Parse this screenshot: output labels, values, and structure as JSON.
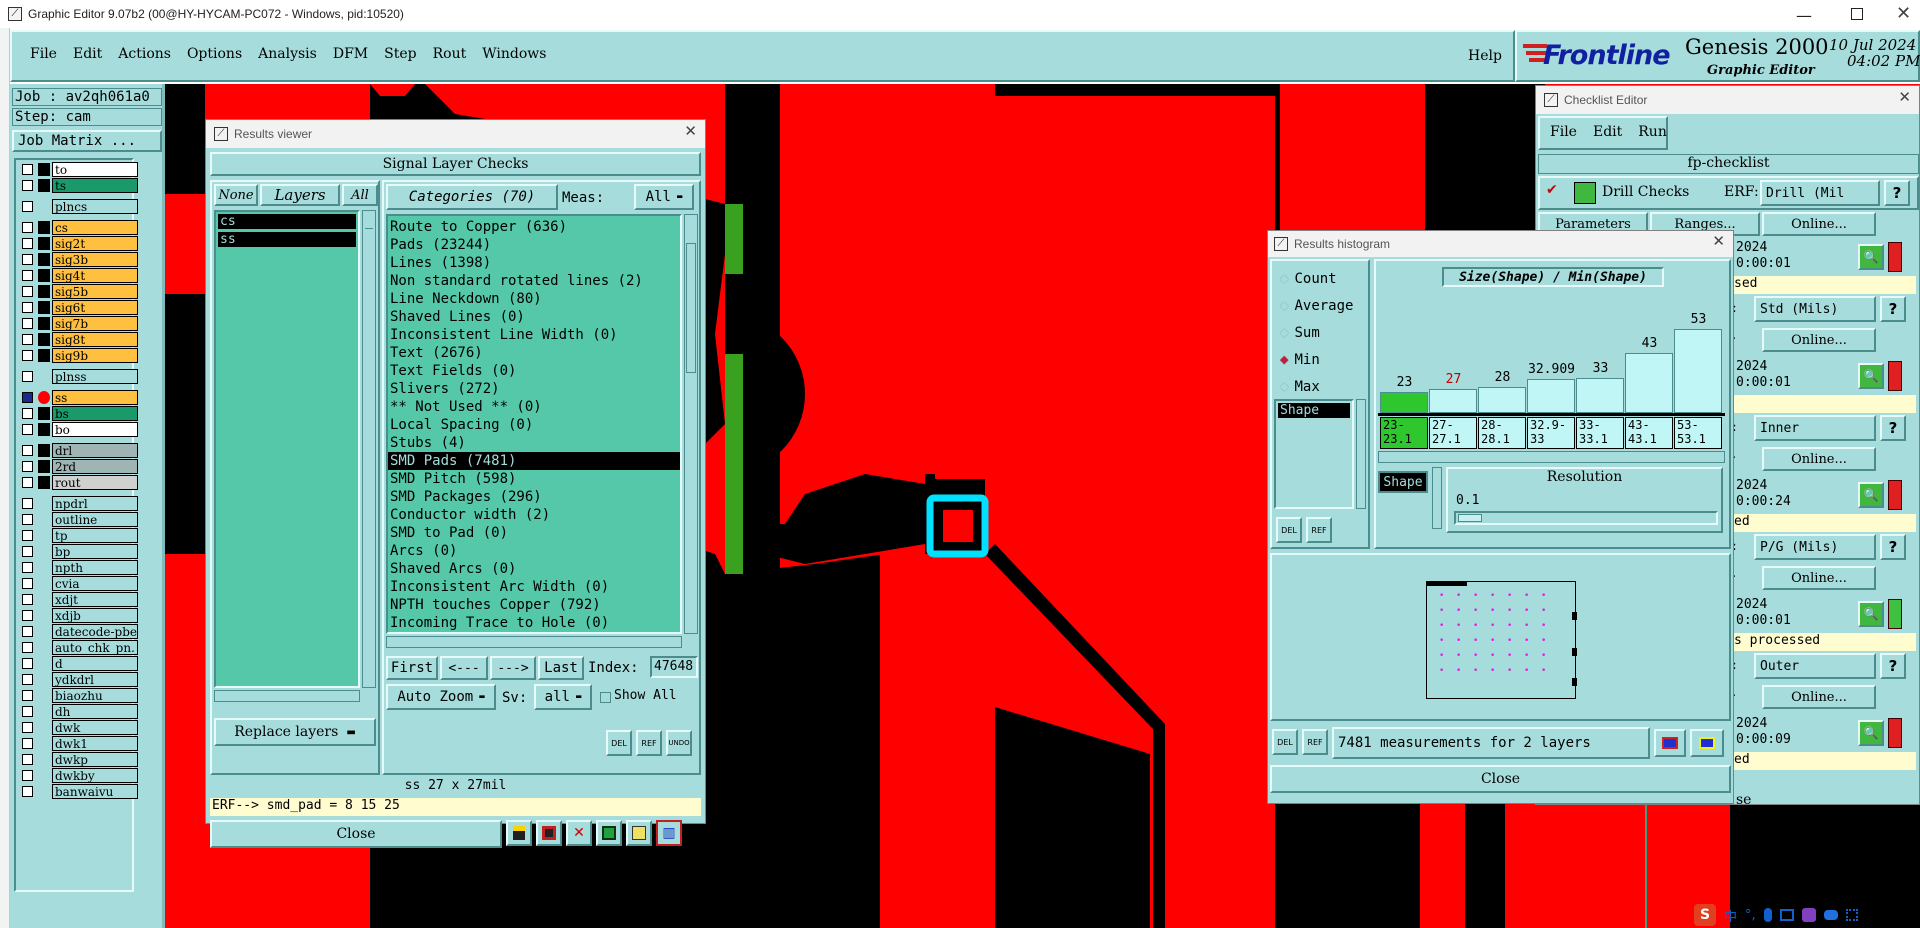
{
  "window": {
    "title": "Graphic Editor 9.07b2 (00@HY-HYCAM-PC072 - Windows, pid:10520)"
  },
  "menu": [
    "File",
    "Edit",
    "Actions",
    "Options",
    "Analysis",
    "DFM",
    "Step",
    "Rout",
    "Windows"
  ],
  "help": "Help",
  "brand": {
    "logo": "Frontline",
    "product": "Genesis 2000",
    "sub": "Graphic Editor",
    "date": "10 Jul 2024",
    "time": "04:02 PM"
  },
  "job": {
    "job": "Job : av2qh061a0",
    "step": "Step: cam",
    "matrix": "Job Matrix ..."
  },
  "layers": [
    {
      "name": "to",
      "color": "#ffffff",
      "box": "#000000"
    },
    {
      "name": "ts",
      "color": "#1a9a6a",
      "box": "#000000"
    },
    {
      "name": "plncs",
      "color": "#a6dcdc",
      "box": "#a6dcdc",
      "gap": true
    },
    {
      "name": "cs",
      "color": "#ffc040",
      "box": "#000000",
      "gap": true
    },
    {
      "name": "sig2t",
      "color": "#ffc040",
      "box": "#000000"
    },
    {
      "name": "sig3b",
      "color": "#ffc040",
      "box": "#000000"
    },
    {
      "name": "sig4t",
      "color": "#ffc040",
      "box": "#000000"
    },
    {
      "name": "sig5b",
      "color": "#ffc040",
      "box": "#000000"
    },
    {
      "name": "sig6t",
      "color": "#ffc040",
      "box": "#000000"
    },
    {
      "name": "sig7b",
      "color": "#ffc040",
      "box": "#000000"
    },
    {
      "name": "sig8t",
      "color": "#ffc040",
      "box": "#000000"
    },
    {
      "name": "sig9b",
      "color": "#ffc040",
      "box": "#000000"
    },
    {
      "name": "plnss",
      "color": "#a6dcdc",
      "box": "#a6dcdc",
      "gap": true
    },
    {
      "name": "ss",
      "color": "#ffc040",
      "box": "#ff0000",
      "sel": true,
      "gap": true
    },
    {
      "name": "bs",
      "color": "#1a9a6a",
      "box": "#000000"
    },
    {
      "name": "bo",
      "color": "#ffffff",
      "box": "#000000"
    },
    {
      "name": "drl",
      "color": "#a0b4b4",
      "box": "#000000",
      "gap": true
    },
    {
      "name": "2rd",
      "color": "#a0b4b4",
      "box": "#000000"
    },
    {
      "name": "rout",
      "color": "#d0d0d0",
      "box": "#000000"
    },
    {
      "name": "npdrl",
      "color": "#a6dcdc",
      "box": "#a6dcdc",
      "gap": true
    },
    {
      "name": "outline",
      "color": "#a6dcdc",
      "box": "#a6dcdc"
    },
    {
      "name": "tp",
      "color": "#a6dcdc",
      "box": "#a6dcdc"
    },
    {
      "name": "bp",
      "color": "#a6dcdc",
      "box": "#a6dcdc"
    },
    {
      "name": "npth",
      "color": "#a6dcdc",
      "box": "#a6dcdc"
    },
    {
      "name": "cvia",
      "color": "#a6dcdc",
      "box": "#a6dcdc"
    },
    {
      "name": "xdjt",
      "color": "#a6dcdc",
      "box": "#a6dcdc"
    },
    {
      "name": "xdjb",
      "color": "#a6dcdc",
      "box": "#a6dcdc"
    },
    {
      "name": "datecode-pbe",
      "color": "#a6dcdc",
      "box": "#a6dcdc"
    },
    {
      "name": "auto_chk_pn.",
      "color": "#a6dcdc",
      "box": "#a6dcdc"
    },
    {
      "name": "d",
      "color": "#a6dcdc",
      "box": "#a6dcdc"
    },
    {
      "name": "ydkdrl",
      "color": "#a6dcdc",
      "box": "#a6dcdc"
    },
    {
      "name": "biaozhu",
      "color": "#a6dcdc",
      "box": "#a6dcdc"
    },
    {
      "name": "dh",
      "color": "#a6dcdc",
      "box": "#a6dcdc"
    },
    {
      "name": "dwk",
      "color": "#a6dcdc",
      "box": "#a6dcdc"
    },
    {
      "name": "dwk1",
      "color": "#a6dcdc",
      "box": "#a6dcdc"
    },
    {
      "name": "dwkp",
      "color": "#a6dcdc",
      "box": "#a6dcdc"
    },
    {
      "name": "dwkby",
      "color": "#a6dcdc",
      "box": "#a6dcdc"
    },
    {
      "name": "banwaivu",
      "color": "#a6dcdc",
      "box": "#a6dcdc"
    }
  ],
  "results": {
    "title": "Results viewer",
    "header": "Signal Layer Checks",
    "none": "None",
    "layers_label": "Layers",
    "all": "All",
    "categories_label": "Categories (70)",
    "meas_label": "Meas:",
    "meas_value": "All",
    "layer_list": [
      "cs",
      "ss"
    ],
    "categories": [
      "Route to Copper (636)",
      "Pads (23244)",
      "Lines (1398)",
      "Non standard rotated lines (2)",
      "Line Neckdown (80)",
      "Shaved Lines (0)",
      "Inconsistent Line Width (0)",
      "Text (2676)",
      "Text Fields (0)",
      "Slivers (272)",
      "** Not Used ** (0)",
      "Local Spacing (0)",
      "Stubs (4)",
      "SMD Pads (7481)",
      "SMD Pitch (598)",
      "SMD Packages (296)",
      "Conductor width (2)",
      "SMD to Pad (0)",
      "Arcs (0)",
      "Shaved Arcs (0)",
      "Inconsistent Arc Width (0)",
      "NPTH touches Copper (792)",
      "Incoming Trace to Hole (0)"
    ],
    "selected_index": 13,
    "first": "First",
    "prev": "<---",
    "next": "--->",
    "last": "Last",
    "index_label": "Index:",
    "index_value": "47648",
    "zoom": "Auto Zoom",
    "sv_label": "Sv:",
    "sv_value": "all",
    "show_all": "Show All",
    "replace": "Replace layers",
    "del": "DEL",
    "ref": "REF",
    "undo": "UNDO",
    "info": "ss 27 x 27mil",
    "erf": "ERF--> smd_pad = 8 15 25",
    "close": "Close"
  },
  "histogram": {
    "title": "Results histogram",
    "options": [
      {
        "label": "Count",
        "on": false
      },
      {
        "label": "Average",
        "on": false
      },
      {
        "label": "Sum",
        "on": false
      },
      {
        "label": "Min",
        "on": true
      },
      {
        "label": "Max",
        "on": false
      }
    ],
    "shape_list": [
      "Shape"
    ],
    "chart_title": "Size(Shape) / Min(Shape)",
    "bars": [
      {
        "value": "23",
        "fill": 0.17,
        "color": "#2ec82e",
        "label": "23- 23.1",
        "red": false
      },
      {
        "value": "27",
        "fill": 0.2,
        "color": "#c0f6f6",
        "label": "27- 27.1",
        "red": true
      },
      {
        "value": "28",
        "fill": 0.21,
        "color": "#c0f6f6",
        "label": "28- 28.1",
        "red": false
      },
      {
        "value": "32.909",
        "fill": 0.28,
        "color": "#c0f6f6",
        "label": "32.9- 33",
        "red": false
      },
      {
        "value": "33",
        "fill": 0.29,
        "color": "#c0f6f6",
        "label": "33- 33.1",
        "red": false
      },
      {
        "value": "43",
        "fill": 0.49,
        "color": "#c0f6f6",
        "label": "43- 43.1",
        "red": false
      },
      {
        "value": "53",
        "fill": 0.69,
        "color": "#c0f6f6",
        "label": "53- 53.1",
        "red": false
      }
    ],
    "shape_tag": "Shape",
    "resolution_label": "Resolution",
    "resolution_value": "0.1",
    "del": "DEL",
    "ref": "REF",
    "summary": "7481 measurements for 2 layers",
    "close": "Close"
  },
  "checklist": {
    "title": "Checklist Editor",
    "menu": [
      "File",
      "Edit",
      "Run"
    ],
    "name": "fp-checklist",
    "drill_checks": "Drill Checks",
    "erf": "ERF:",
    "erf_value": "Drill (Mil",
    "parameters": "Parameters",
    "ranges": "Ranges...",
    "online": "Online...",
    "rows": [
      {
        "date": "2024",
        "time": "0:00:01",
        "status": "sed",
        "erf": "Std (Mils)",
        "flag": "red"
      },
      {
        "date": "2024",
        "time": "0:00:01",
        "status": "",
        "erf": "Inner",
        "flag": "red"
      },
      {
        "date": "2024",
        "time": "0:00:24",
        "status": "ed",
        "erf": "P/G (Mils)",
        "flag": "red"
      },
      {
        "date": "2024",
        "time": "0:00:01",
        "status": "s processed",
        "erf": "Outer",
        "flag": "green"
      },
      {
        "date": "2024",
        "time": "0:00:09",
        "status": "ed",
        "erf": "",
        "flag": "red"
      }
    ],
    "bottom": "se"
  }
}
